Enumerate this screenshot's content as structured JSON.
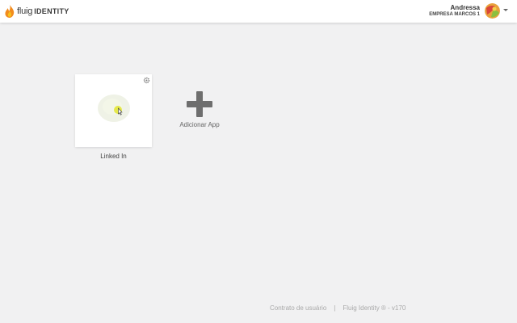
{
  "header": {
    "brand": "fluig",
    "product": "IDENTITY",
    "user_name": "Andressa",
    "company": "EMPRESA MARCOS 1"
  },
  "apps": [
    {
      "label": "Linked In",
      "icon": "linkedin-icon"
    }
  ],
  "add_app": {
    "label": "Adicionar App",
    "icon": "plus-icon"
  },
  "footer": {
    "terms": "Contrato de usuário",
    "separator": "|",
    "version": "Fluig Identity ® - v170"
  },
  "colors": {
    "background": "#f1f1f2",
    "header_bg": "#ffffff",
    "plus_icon": "#6e6e6e",
    "flame_orange": "#f28c1e",
    "flame_yellow": "#f8c11c"
  }
}
